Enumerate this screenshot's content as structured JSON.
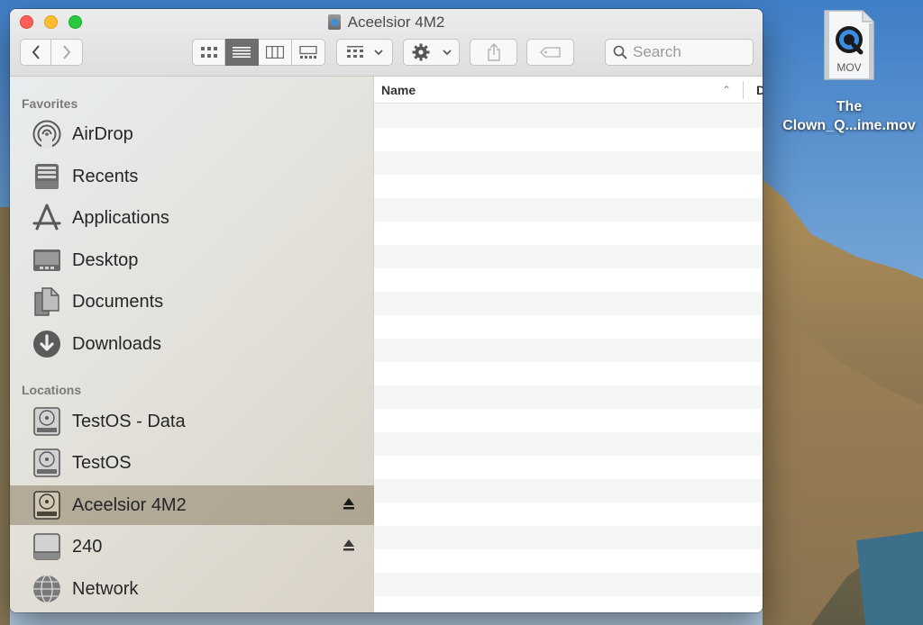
{
  "window": {
    "title": "Aceelsior 4M2"
  },
  "toolbar": {
    "back_icon": "chevron-left-icon",
    "forward_icon": "chevron-right-icon",
    "view_modes": [
      "icon-view-icon",
      "list-view-icon",
      "column-view-icon",
      "gallery-view-icon"
    ],
    "active_view": "list",
    "search_placeholder": "Search"
  },
  "sidebar": {
    "favorites_label": "Favorites",
    "favorites": [
      {
        "label": "AirDrop",
        "icon": "airdrop-icon"
      },
      {
        "label": "Recents",
        "icon": "recents-icon"
      },
      {
        "label": "Applications",
        "icon": "applications-icon"
      },
      {
        "label": "Desktop",
        "icon": "desktop-icon"
      },
      {
        "label": "Documents",
        "icon": "documents-icon"
      },
      {
        "label": "Downloads",
        "icon": "downloads-icon"
      }
    ],
    "locations_label": "Locations",
    "locations": [
      {
        "label": "TestOS - Data",
        "icon": "disk-icon",
        "eject": false
      },
      {
        "label": "TestOS",
        "icon": "disk-icon",
        "eject": false
      },
      {
        "label": "Aceelsior 4M2",
        "icon": "disk-icon",
        "eject": true,
        "selected": true
      },
      {
        "label": "240",
        "icon": "external-drive-icon",
        "eject": true
      },
      {
        "label": "Network",
        "icon": "network-icon",
        "eject": false
      }
    ]
  },
  "list": {
    "name_header": "Name",
    "second_header": "D",
    "sort": "ascending",
    "row_count": 0
  },
  "desktop": {
    "file_badge": "MOV",
    "file_name_line1": "The",
    "file_name_line2": "Clown_Q...ime.mov"
  },
  "colors": {
    "selected_bg": "#8c7e64",
    "close": "#fe5f57",
    "minimize": "#febc2e",
    "maximize": "#28c840"
  }
}
